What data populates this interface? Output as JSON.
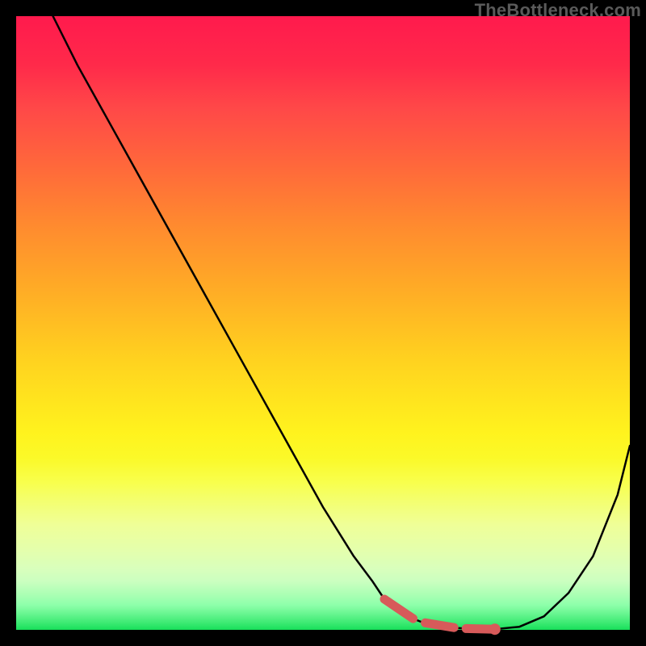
{
  "watermark": "TheBottleneck.com",
  "colors": {
    "curve": "#000000",
    "marker": "#d75a5a",
    "gradient_top": "#ff1a4d",
    "gradient_bottom": "#18e05a"
  },
  "chart_data": {
    "type": "line",
    "title": "",
    "xlabel": "",
    "ylabel": "",
    "xlim": [
      0,
      100
    ],
    "ylim": [
      0,
      100
    ],
    "grid": false,
    "legend": false,
    "series": [
      {
        "name": "curve",
        "x": [
          6,
          10,
          15,
          20,
          25,
          30,
          35,
          40,
          45,
          50,
          55,
          58,
          60,
          63,
          66,
          69,
          72,
          75,
          78,
          82,
          86,
          90,
          94,
          98,
          100
        ],
        "y": [
          100,
          92,
          83,
          74,
          65,
          56,
          47,
          38,
          29,
          20,
          12,
          8,
          5,
          2.5,
          1.3,
          0.6,
          0.3,
          0.1,
          0.1,
          0.5,
          2.2,
          6.0,
          12.0,
          22.0,
          30.0
        ]
      }
    ],
    "optimal_range_x": [
      60,
      78
    ],
    "marker_point_x": 78,
    "annotations": []
  }
}
